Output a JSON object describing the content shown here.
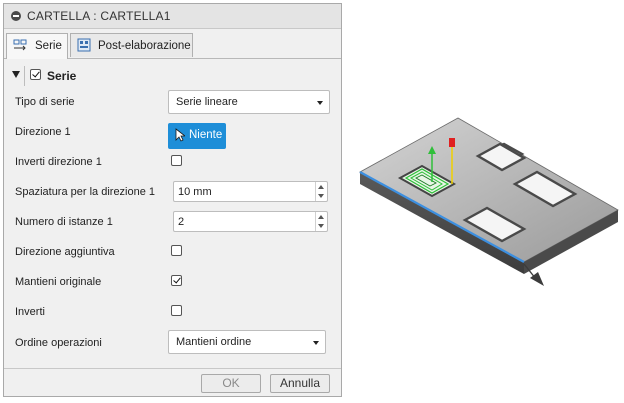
{
  "dialog": {
    "title": "CARTELLA : CARTELLA1",
    "tabs": [
      {
        "label": "Serie",
        "active": true,
        "icon": "pattern-icon"
      },
      {
        "label": "Post-elaborazione",
        "active": false,
        "icon": "post-processing-icon"
      }
    ],
    "section": {
      "title": "Serie",
      "checked": true
    },
    "rows": {
      "tipo_di_serie": {
        "label": "Tipo di serie",
        "value": "Serie lineare"
      },
      "direzione_1": {
        "label": "Direzione 1",
        "button": "Niente"
      },
      "inverti_direzione_1": {
        "label": "Inverti direzione 1",
        "checked": false
      },
      "spaziatura": {
        "label": "Spaziatura per la direzione 1",
        "value": "10 mm"
      },
      "numero_istanze": {
        "label": "Numero di istanze 1",
        "value": "2"
      },
      "direzione_aggiuntiva": {
        "label": "Direzione aggiuntiva",
        "checked": false
      },
      "mantieni_originale": {
        "label": "Mantieni originale",
        "checked": true
      },
      "inverti": {
        "label": "Inverti",
        "checked": false
      },
      "ordine_operazioni": {
        "label": "Ordine operazioni",
        "value": "Mantieni ordine"
      }
    },
    "footer": {
      "ok": "OK",
      "cancel": "Annulla"
    }
  },
  "colors": {
    "accent_blue": "#1e8ed8",
    "direction_line": "#3c8fe0",
    "toolpath_green": "#2fbf3a",
    "axis_red": "#e02020",
    "axis_yellow": "#f0d000"
  }
}
